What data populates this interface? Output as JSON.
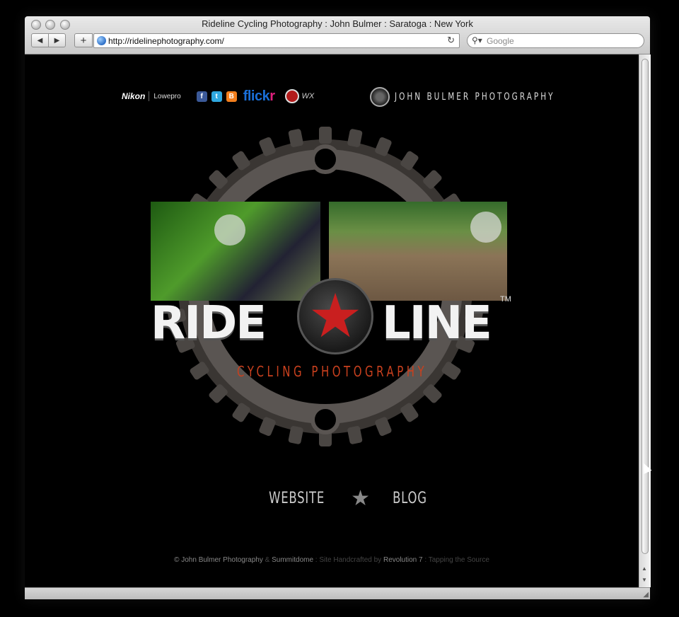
{
  "window": {
    "title": "Rideline Cycling Photography : John Bulmer : Saratoga : New York"
  },
  "toolbar": {
    "back_label": "◀",
    "forward_label": "▶",
    "add_label": "+",
    "url": "http://ridelinephotography.com/",
    "search_placeholder": "Google"
  },
  "sponsors": {
    "nikon": "Nikon",
    "lowepro": "Lowepro",
    "facebook": "f",
    "twitter": "t",
    "blogger": "B",
    "flickr_a": "flick",
    "flickr_b": "r",
    "wx": "WX"
  },
  "brand": {
    "name": "JOHN BULMER PHOTOGRAPHY"
  },
  "logo": {
    "ride": "RIDE",
    "line": "LINE",
    "tm": "TM",
    "tagline": "CYCLING PHOTOGRAPHY"
  },
  "nav": {
    "website": "WEBSITE",
    "blog": "BLOG"
  },
  "footer": {
    "copyright": "© John Bulmer Photography",
    "amp": " & ",
    "summitdome": "Summitdome",
    "handcrafted": " : Site Handcrafted by ",
    "revolution": "Revolution 7",
    "tapping": " : Tapping the Source"
  },
  "colors": {
    "accent_red": "#c91f1f",
    "tagline_orange": "#c8401e",
    "flickr_blue": "#1a6fd8"
  }
}
